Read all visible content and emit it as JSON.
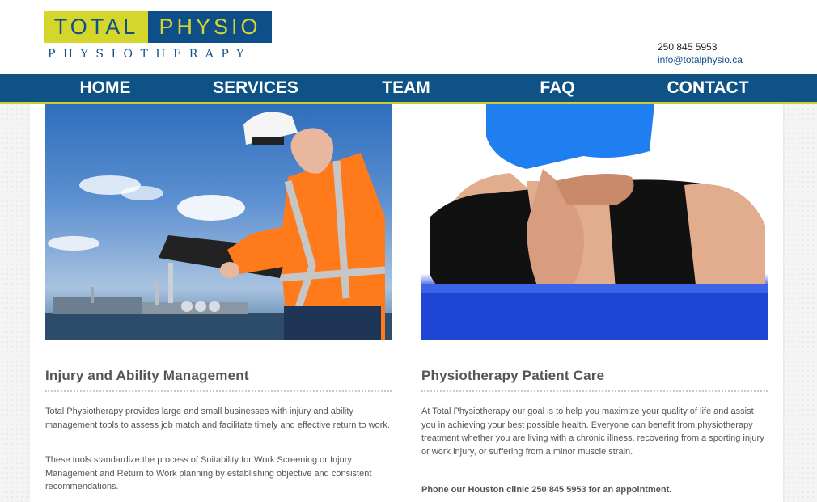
{
  "header": {
    "logo": {
      "word1": "TOTAL",
      "word2": "PHYSIO",
      "subtitle": "PHYSIOTHERAPY"
    },
    "phone": "250 845 5953",
    "email": "info@totalphysio.ca"
  },
  "nav": {
    "items": [
      {
        "label": "HOME"
      },
      {
        "label": "SERVICES"
      },
      {
        "label": "TEAM"
      },
      {
        "label": "FAQ"
      },
      {
        "label": "CONTACT"
      }
    ]
  },
  "colors": {
    "brand_blue": "#0e5286",
    "brand_yellow": "#d4d62c"
  },
  "sections": [
    {
      "heading": "Injury and Ability Management",
      "paragraphs": [
        "Total Physiotherapy provides large and small businesses with injury and ability management tools to assess job match and facilitate timely and effective return to work.",
        "These tools standardize the process of Suitability for Work Screening or Injury Management and Return to Work planning by establishing objective and consistent recommendations."
      ]
    },
    {
      "heading": "Physiotherapy Patient Care",
      "paragraphs": [
        "At Total Physiotherapy our goal is to help you maximize your quality of life and assist you in achieving your best possible health. Everyone can benefit from physiotherapy treatment whether you are living with a chronic illness, recovering from a sporting injury or work injury, or suffering from a minor muscle strain."
      ],
      "cta": "Phone our Houston clinic 250 845 5953 for an appointment."
    }
  ]
}
